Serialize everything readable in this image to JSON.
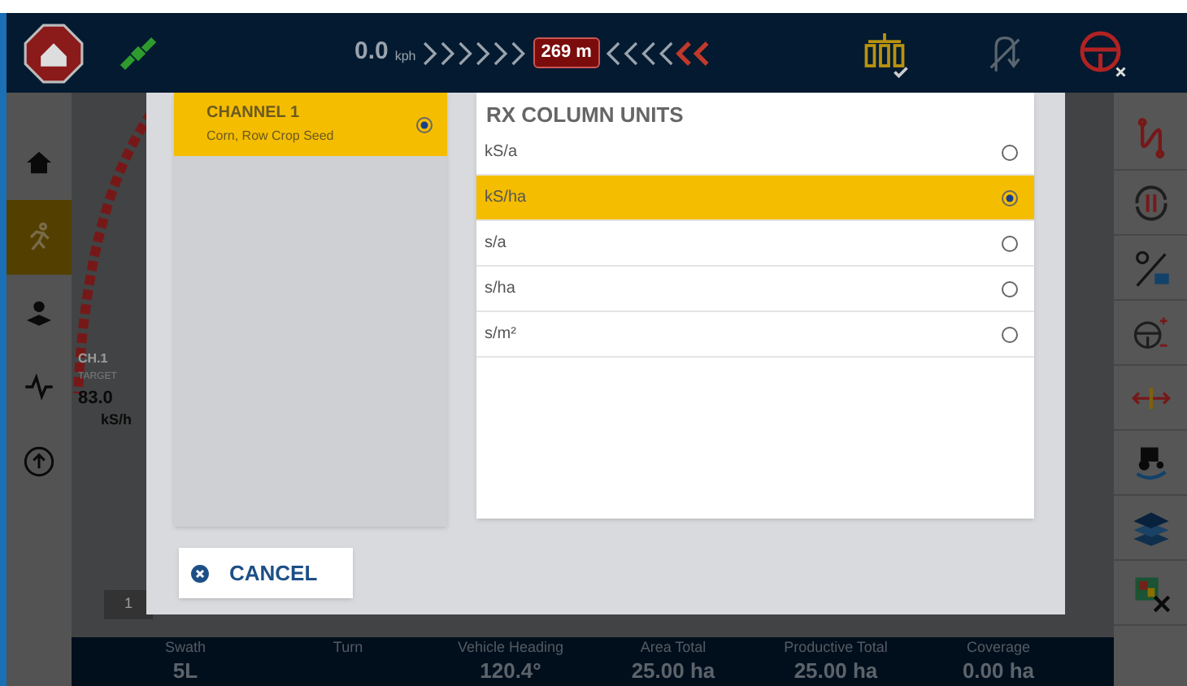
{
  "top_bar": {
    "speed": "0.0",
    "speed_unit": "kph",
    "distance": "269 m"
  },
  "left_nav": [
    {
      "kind": "home",
      "selected": false
    },
    {
      "kind": "run",
      "selected": true
    },
    {
      "kind": "field",
      "selected": false
    },
    {
      "kind": "pulse",
      "selected": false
    },
    {
      "kind": "upload",
      "selected": false
    }
  ],
  "map_panel": {
    "channel_label": "CH.1",
    "target_label": "TARGET",
    "target_value": "83.0",
    "target_unit": "kS/h",
    "sections": [
      "1"
    ]
  },
  "status_bar": [
    {
      "label": "Swath",
      "value": "5L"
    },
    {
      "label": "Turn"
    },
    {
      "label": "Vehicle Heading",
      "value": "120.4°"
    },
    {
      "label": "Area Total",
      "value": "25.00 ha"
    },
    {
      "label": "Productive Total",
      "value": "25.00 ha"
    },
    {
      "label": "Coverage",
      "value": "0.00 ha"
    }
  ],
  "dialog": {
    "channels": [
      {
        "name": "CHANNEL 1",
        "crop": "Corn, Row Crop Seed",
        "selected": true
      }
    ],
    "units_title": "RX COLUMN UNITS",
    "units": [
      {
        "label": "kS/a",
        "selected": false
      },
      {
        "label": "kS/ha",
        "selected": true
      },
      {
        "label": "s/a",
        "selected": false
      },
      {
        "label": "s/ha",
        "selected": false
      },
      {
        "label": "s/m²",
        "selected": false
      }
    ],
    "cancel": "CANCEL"
  }
}
